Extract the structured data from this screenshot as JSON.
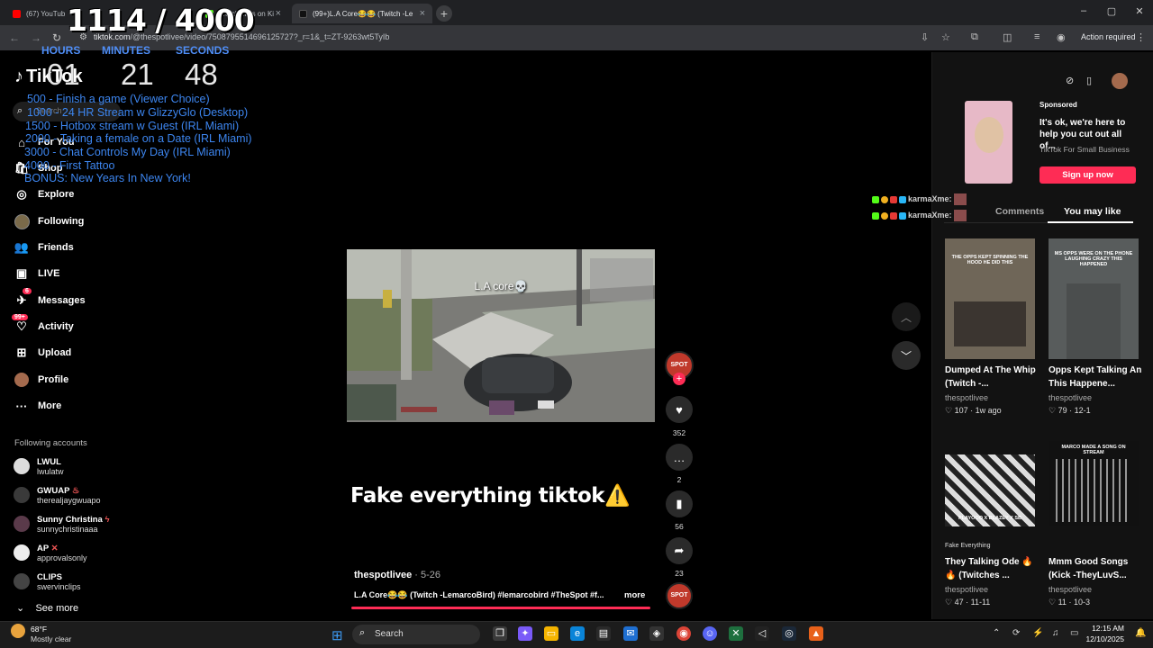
{
  "browser": {
    "tabs": [
      {
        "title": "(67) YouTub"
      },
      {
        "title": "Watch clips on Ki"
      },
      {
        "title": "(99+)L.A Core😂😂 (Twitch -Le"
      }
    ],
    "url_domain": "tiktok.com",
    "url_rest": "/@thespotlivee/video/7508795514696125727?_r=1&_t=ZT-9263wt5TyIb",
    "action_required": "Action required"
  },
  "overlay": {
    "counter": "1114 / 4000",
    "timer": {
      "hours_label": "HOURS",
      "hours": "01",
      "minutes_label": "MINUTES",
      "minutes": "21",
      "seconds_label": "SECONDS",
      "seconds": "48"
    },
    "goals": [
      "500 - Finish a game (Viewer Choice)",
      "1000 - 24 HR Stream w GlizzyGlo (Desktop)",
      "1500 - Hotbox stream w Guest (IRL Miami)",
      "2000 - Taking a female on a Date (IRL Miami)",
      "3000 - Chat Controls My Day (IRL Miami)",
      "4000 - First Tattoo",
      "BONUS: New Years In New York!"
    ]
  },
  "sidebar": {
    "logo": "TikTok",
    "search_placeholder": "Search",
    "nav": [
      {
        "label": "For You",
        "icon": "home-icon"
      },
      {
        "label": "Shop",
        "icon": "shop-icon"
      },
      {
        "label": "Explore",
        "icon": "compass-icon"
      },
      {
        "label": "Following",
        "icon": "following-icon"
      },
      {
        "label": "Friends",
        "icon": "friends-icon"
      },
      {
        "label": "LIVE",
        "icon": "live-icon"
      },
      {
        "label": "Messages",
        "icon": "messages-icon",
        "badge": "6"
      },
      {
        "label": "Activity",
        "icon": "activity-icon",
        "badge": "99+"
      },
      {
        "label": "Upload",
        "icon": "upload-icon"
      },
      {
        "label": "Profile",
        "icon": "profile-icon"
      },
      {
        "label": "More",
        "icon": "more-icon"
      }
    ],
    "following_title": "Following accounts",
    "accounts": [
      {
        "name": "LWUL",
        "handle": "lwulatw"
      },
      {
        "name": "GWUAP",
        "handle": "therealjaygwuapo"
      },
      {
        "name": "Sunny Christina",
        "handle": "sunnychristinaaa"
      },
      {
        "name": "AP",
        "handle": "approvalsonly"
      },
      {
        "name": "CLIPS",
        "handle": "swervinclips"
      }
    ],
    "see_more": "See more"
  },
  "video": {
    "caption": "L.A core💀",
    "headline": "Fake everything tiktok⚠️",
    "author": "thespotlivee",
    "date": "· 5-26",
    "description": "L.A Core😂😂 (Twitch -LemarcoBird) #lemarcobird #TheSpot #f...",
    "more": "more",
    "creator_badge": "SPOT",
    "likes": "352",
    "comments": "2",
    "saves": "56",
    "shares": "23"
  },
  "right_panel": {
    "sponsored": "Sponsored",
    "ad_text": "It's ok, we're here to help you cut out all of...",
    "ad_brand": "TikTok For Small Business",
    "signup": "Sign up now",
    "tab_comments": "Comments",
    "tab_like": "You may like",
    "cards": [
      {
        "caption": "THE OPPS KEPT SPINNING THE HOOD HE DID THIS",
        "title": "Dumped At The Whip (Twitch -...",
        "user": "thespotlivee",
        "likes": "107",
        "age": "1w ago"
      },
      {
        "caption": "MS OPPS WERE ON THE PHONE LAUGHING CRAZY THIS HAPPENED",
        "title": "Opps Kept Talking An This Happene...",
        "user": "thespotlivee",
        "likes": "79",
        "age": "12-1"
      },
      {
        "caption": "PLAYOOO X BLAZEY X SB",
        "tag": "Fake Everything",
        "title": "They Talking Ode 🔥🔥 (Twitches ...",
        "user": "thespotlivee",
        "likes": "47",
        "age": "11-11"
      },
      {
        "caption": "MARCO MADE A SONG ON STREAM",
        "title": "Mmm Good Songs (Kick -TheyLuvS...",
        "user": "thespotlivee",
        "likes": "11",
        "age": "10-3"
      }
    ]
  },
  "chat": [
    {
      "user": "karmaXme:"
    },
    {
      "user": "karmaXme:"
    }
  ],
  "taskbar": {
    "temp": "68°F",
    "weather": "Mostly clear",
    "search": "Search",
    "time": "12:15 AM",
    "date": "12/10/2025"
  }
}
